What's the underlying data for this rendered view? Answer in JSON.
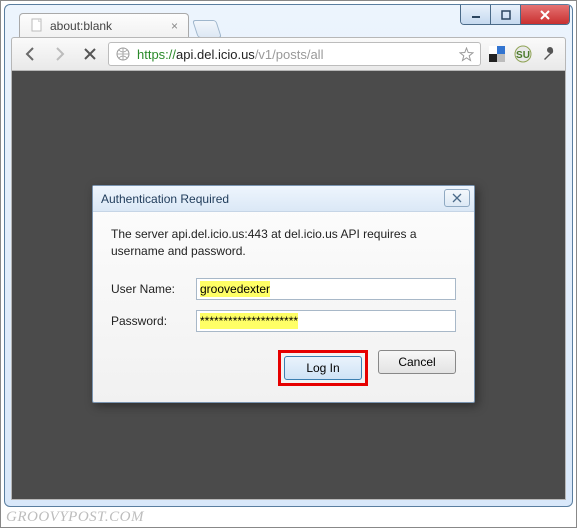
{
  "tab": {
    "title": "about:blank"
  },
  "url": {
    "scheme": "https://",
    "host": "api.del.icio.us",
    "path": "/v1/posts/all"
  },
  "dialog": {
    "title": "Authentication Required",
    "message": "The server api.del.icio.us:443 at del.icio.us API requires a username and password.",
    "username_label": "User Name:",
    "password_label": "Password:",
    "username_value": "groovedexter",
    "password_value": "*********************",
    "login_label": "Log In",
    "cancel_label": "Cancel"
  },
  "watermark": "GROOVYPOST.COM"
}
